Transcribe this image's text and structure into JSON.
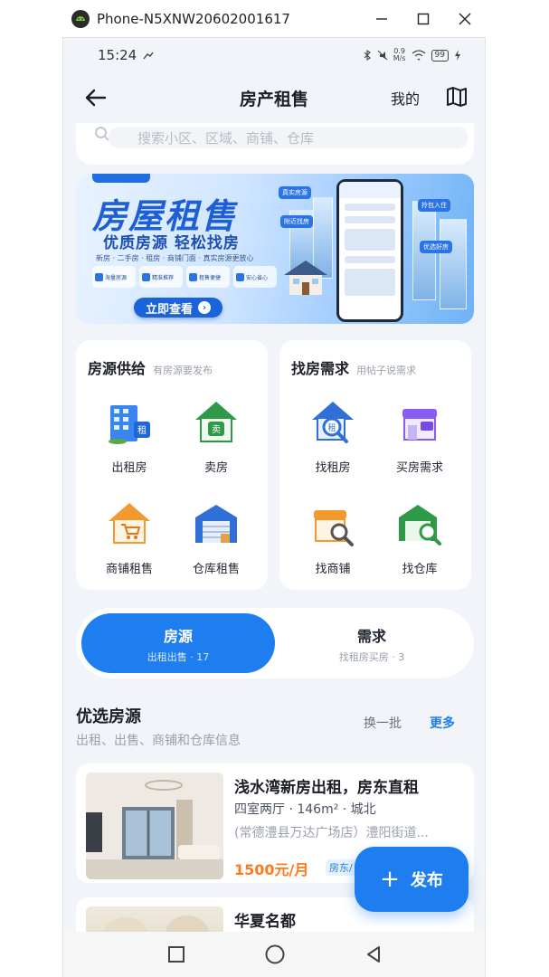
{
  "window": {
    "title": "Phone-N5XNW20602001617"
  },
  "statusbar": {
    "time": "15:24",
    "net_value": "0.9",
    "net_unit": "M/s",
    "battery": "99"
  },
  "appbar": {
    "title": "房产租售",
    "mine": "我的"
  },
  "search": {
    "placeholder": "搜索小区、区域、商铺、仓库"
  },
  "banner": {
    "title": "房屋租售",
    "subtitle": "优质房源 轻松找房",
    "desc": "新房 · 二手房 · 租房 · 商铺门面 · 真实房源更放心",
    "features": [
      "海量房源",
      "精准推荐",
      "租售便捷",
      "安心省心"
    ],
    "cta": "立即查看",
    "badges": [
      "真实房源",
      "附近找房",
      "拎包入住",
      "优选好房"
    ]
  },
  "supply": {
    "title": "房源供给",
    "subtitle": "有房源要发布",
    "items": [
      {
        "label": "出租房",
        "icon": "rent-building-icon"
      },
      {
        "label": "卖房",
        "icon": "sell-house-icon"
      },
      {
        "label": "商铺租售",
        "icon": "shop-cart-icon"
      },
      {
        "label": "仓库租售",
        "icon": "warehouse-icon"
      }
    ]
  },
  "demand": {
    "title": "找房需求",
    "subtitle": "用帖子说需求",
    "items": [
      {
        "label": "找租房",
        "icon": "find-rent-icon"
      },
      {
        "label": "买房需求",
        "icon": "buy-shop-icon"
      },
      {
        "label": "找商铺",
        "icon": "find-shop-icon"
      },
      {
        "label": "找仓库",
        "icon": "find-warehouse-icon"
      }
    ]
  },
  "tabs": [
    {
      "name": "房源",
      "info": "出租出售 · 17",
      "active": true
    },
    {
      "name": "需求",
      "info": "找租房买房 · 3",
      "active": false
    }
  ],
  "featured": {
    "title": "优选房源",
    "subtitle": "出租、出售、商铺和仓库信息",
    "refresh": "换一批",
    "more": "更多"
  },
  "listings": [
    {
      "title": "浅水湾新房出租，房东直租",
      "meta": "四室两厅 · 146m² · 城北",
      "address": "(常德澧县万达广场店）澧阳街道...",
      "price": "1500元/月",
      "tag": "房东/"
    },
    {
      "title": "华夏名都"
    }
  ],
  "fab": {
    "label": "发布"
  },
  "colors": {
    "primary": "#1e7ef0",
    "price": "#ff7a1a",
    "background": "#f1f4f8"
  }
}
